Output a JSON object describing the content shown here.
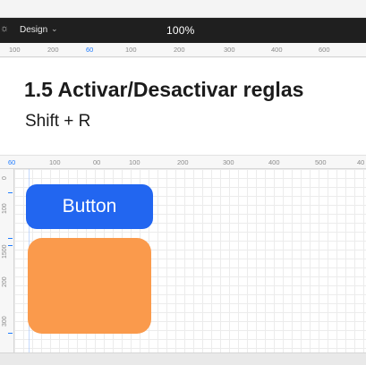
{
  "topbar": {
    "tab_label": "Design",
    "zoom": "100%"
  },
  "ruler_top_upper": [
    "100",
    "200",
    "60",
    "100",
    "200",
    "300",
    "400",
    "600"
  ],
  "ruler_top_lower": [
    "60",
    "100",
    "00",
    "100",
    "200",
    "300",
    "400",
    "500",
    "40"
  ],
  "ruler_left": [
    "0",
    "100",
    "1500",
    "200",
    "300"
  ],
  "panel": {
    "title": "1.5 Activar/Desactivar reglas",
    "shortcut": "Shift + R"
  },
  "canvas": {
    "button_label": "Button",
    "button_color": "#2266f0",
    "shape_color": "#fa9a4c"
  }
}
